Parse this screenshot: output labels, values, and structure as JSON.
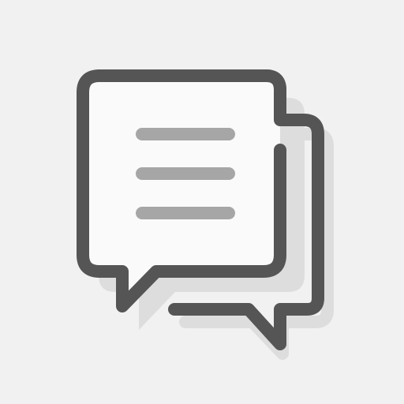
{
  "icon": {
    "name": "chat-bubbles-icon",
    "colors": {
      "background": "#f1f1f1",
      "outline": "#555555",
      "fill": "#fafafa",
      "shadow": "#dddddd",
      "text_lines": "#a6a6a6"
    }
  }
}
